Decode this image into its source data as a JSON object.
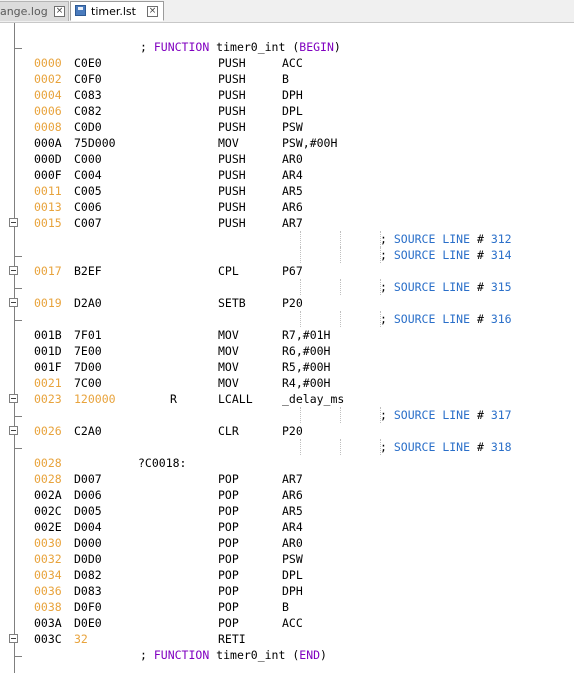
{
  "tabs": [
    {
      "label": "hange.log",
      "active": false
    },
    {
      "label": "timer.lst",
      "active": true
    }
  ],
  "colors": {
    "address_orange": "#e8a33c",
    "keyword_purple": "#8000c0",
    "comment_blue": "#2a6fc9"
  },
  "header": {
    "prefix": "; ",
    "keyword": "FUNCTION",
    "name": "timer0_int",
    "tag": "BEGIN"
  },
  "footer": {
    "prefix": "; ",
    "keyword": "FUNCTION",
    "name": "timer0_int",
    "tag": "END"
  },
  "lines": [
    {
      "addr": "0000",
      "addr_color": "orange",
      "hex": "C0E0",
      "mnem": "PUSH",
      "oper": "ACC"
    },
    {
      "addr": "0002",
      "addr_color": "orange",
      "hex": "C0F0",
      "mnem": "PUSH",
      "oper": "B"
    },
    {
      "addr": "0004",
      "addr_color": "orange",
      "hex": "C083",
      "mnem": "PUSH",
      "oper": "DPH"
    },
    {
      "addr": "0006",
      "addr_color": "orange",
      "hex": "C082",
      "mnem": "PUSH",
      "oper": "DPL"
    },
    {
      "addr": "0008",
      "addr_color": "orange",
      "hex": "C0D0",
      "mnem": "PUSH",
      "oper": "PSW"
    },
    {
      "addr": "000A",
      "addr_color": "black",
      "hex": "75D000",
      "mnem": "MOV",
      "oper": "PSW,#00H"
    },
    {
      "addr": "000D",
      "addr_color": "black",
      "hex": "C000",
      "mnem": "PUSH",
      "oper": "AR0"
    },
    {
      "addr": "000F",
      "addr_color": "black",
      "hex": "C004",
      "mnem": "PUSH",
      "oper": "AR4"
    },
    {
      "addr": "0011",
      "addr_color": "orange",
      "hex": "C005",
      "mnem": "PUSH",
      "oper": "AR5"
    },
    {
      "addr": "0013",
      "addr_color": "orange",
      "hex": "C006",
      "mnem": "PUSH",
      "oper": "AR6"
    },
    {
      "addr": "0015",
      "addr_color": "orange",
      "hex": "C007",
      "mnem": "PUSH",
      "oper": "AR7",
      "fold": "box"
    },
    {
      "comment": "; SOURCE LINE # 312"
    },
    {
      "comment": "; SOURCE LINE # 314",
      "fold": "end"
    },
    {
      "addr": "0017",
      "addr_color": "orange",
      "hex": "B2EF",
      "mnem": "CPL",
      "oper": "P67",
      "fold": "box"
    },
    {
      "comment": "; SOURCE LINE # 315",
      "fold": "end"
    },
    {
      "addr": "0019",
      "addr_color": "orange",
      "hex": "D2A0",
      "mnem": "SETB",
      "oper": "P20",
      "fold": "box"
    },
    {
      "comment": "; SOURCE LINE # 316",
      "fold": "end"
    },
    {
      "addr": "001B",
      "addr_color": "black",
      "hex": "7F01",
      "mnem": "MOV",
      "oper": "R7,#01H"
    },
    {
      "addr": "001D",
      "addr_color": "black",
      "hex": "7E00",
      "mnem": "MOV",
      "oper": "R6,#00H"
    },
    {
      "addr": "001F",
      "addr_color": "black",
      "hex": "7D00",
      "mnem": "MOV",
      "oper": "R5,#00H"
    },
    {
      "addr": "0021",
      "addr_color": "orange",
      "hex": "7C00",
      "mnem": "MOV",
      "oper": "R4,#00H"
    },
    {
      "addr": "0023",
      "addr_color": "orange",
      "hex": "120000",
      "hex_color": "orange",
      "col3": "R",
      "mnem": "LCALL",
      "oper": "_delay_ms",
      "fold": "box"
    },
    {
      "comment": "; SOURCE LINE # 317",
      "fold": "end"
    },
    {
      "addr": "0026",
      "addr_color": "orange",
      "hex": "C2A0",
      "mnem": "CLR",
      "oper": "P20",
      "fold": "box"
    },
    {
      "comment": "; SOURCE LINE # 318",
      "fold": "end"
    },
    {
      "addr": "0028",
      "addr_color": "orange",
      "label": "?C0018:"
    },
    {
      "addr": "0028",
      "addr_color": "orange",
      "hex": "D007",
      "mnem": "POP",
      "oper": "AR7"
    },
    {
      "addr": "002A",
      "addr_color": "black",
      "hex": "D006",
      "mnem": "POP",
      "oper": "AR6"
    },
    {
      "addr": "002C",
      "addr_color": "black",
      "hex": "D005",
      "mnem": "POP",
      "oper": "AR5"
    },
    {
      "addr": "002E",
      "addr_color": "black",
      "hex": "D004",
      "mnem": "POP",
      "oper": "AR4"
    },
    {
      "addr": "0030",
      "addr_color": "orange",
      "hex": "D000",
      "mnem": "POP",
      "oper": "AR0"
    },
    {
      "addr": "0032",
      "addr_color": "orange",
      "hex": "D0D0",
      "mnem": "POP",
      "oper": "PSW"
    },
    {
      "addr": "0034",
      "addr_color": "orange",
      "hex": "D082",
      "mnem": "POP",
      "oper": "DPL"
    },
    {
      "addr": "0036",
      "addr_color": "orange",
      "hex": "D083",
      "mnem": "POP",
      "oper": "DPH"
    },
    {
      "addr": "0038",
      "addr_color": "orange",
      "hex": "D0F0",
      "mnem": "POP",
      "oper": "B"
    },
    {
      "addr": "003A",
      "addr_color": "black",
      "hex": "D0E0",
      "mnem": "POP",
      "oper": "ACC"
    },
    {
      "addr": "003C",
      "addr_color": "black",
      "hex": "32",
      "hex_color": "orange",
      "mnem": "RETI",
      "fold": "box"
    }
  ]
}
